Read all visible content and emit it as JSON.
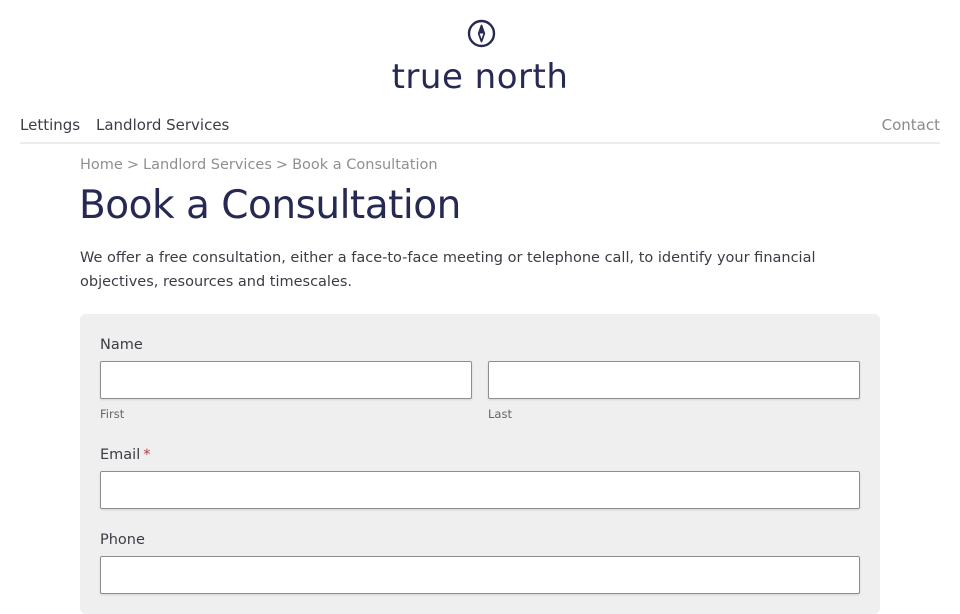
{
  "site": {
    "logo_text": "true north",
    "logo_icon": "compass-icon",
    "brand_color": "#262a52"
  },
  "nav": {
    "items": [
      {
        "label": "Lettings"
      },
      {
        "label": "Landlord Services"
      }
    ],
    "contact_label": "Contact"
  },
  "breadcrumb": {
    "items": [
      "Home",
      "Landlord Services",
      "Book a Consultation"
    ],
    "separator": ">"
  },
  "page": {
    "title": "Book a Consultation",
    "intro": "We offer a free consultation, either a face-to-face meeting or telephone call, to identify your financial objectives, resources and timescales."
  },
  "form": {
    "name_label": "Name",
    "first_sublabel": "First",
    "last_sublabel": "Last",
    "first_value": "",
    "last_value": "",
    "email_label": "Email",
    "email_required_mark": "*",
    "email_value": "",
    "phone_label": "Phone",
    "phone_value": "",
    "panel_color": "#efefef",
    "required_color": "#b33a3a"
  }
}
